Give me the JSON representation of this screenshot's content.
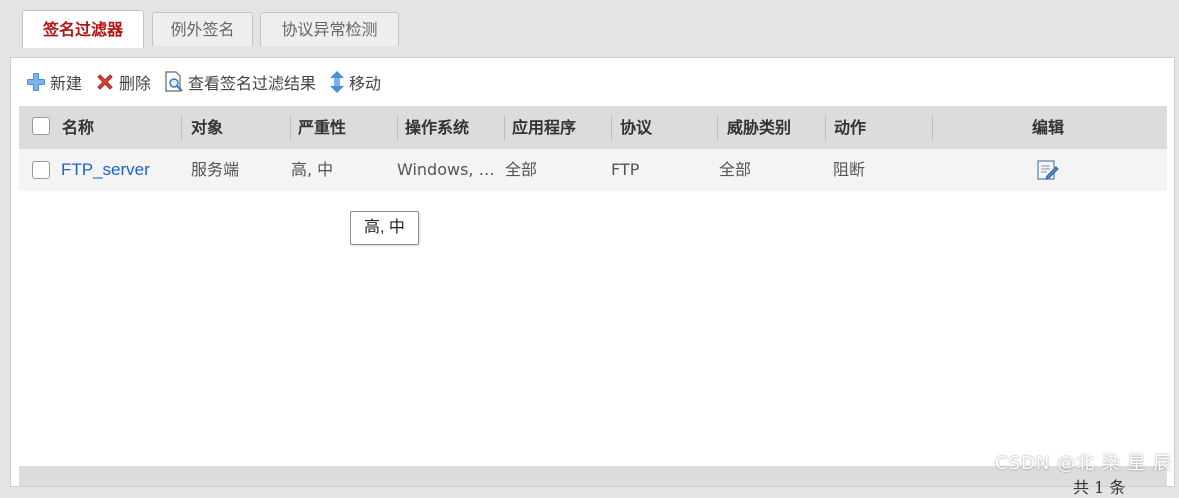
{
  "tabs": [
    {
      "label": "签名过滤器",
      "active": true
    },
    {
      "label": "例外签名",
      "active": false
    },
    {
      "label": "协议异常检测",
      "active": false
    }
  ],
  "toolbar": {
    "new_label": "新建",
    "delete_label": "删除",
    "view_label": "查看签名过滤结果",
    "move_label": "移动"
  },
  "table": {
    "headers": [
      "名称",
      "对象",
      "严重性",
      "操作系统",
      "应用程序",
      "协议",
      "威胁类别",
      "动作",
      "编辑"
    ],
    "rows": [
      {
        "name": "FTP_server",
        "object": "服务端",
        "severity": "高, 中",
        "os": "Windows, …",
        "application": "全部",
        "protocol": "FTP",
        "threat": "全部",
        "action": "阻断"
      }
    ]
  },
  "tooltip": "高, 中",
  "footer": {
    "count_text": "共 1 条"
  },
  "watermark": "CSDN @北 染 星 辰",
  "colors": {
    "active_tab": "#b41414",
    "link": "#1b62c8",
    "header_bg": "#dcdcdc"
  }
}
